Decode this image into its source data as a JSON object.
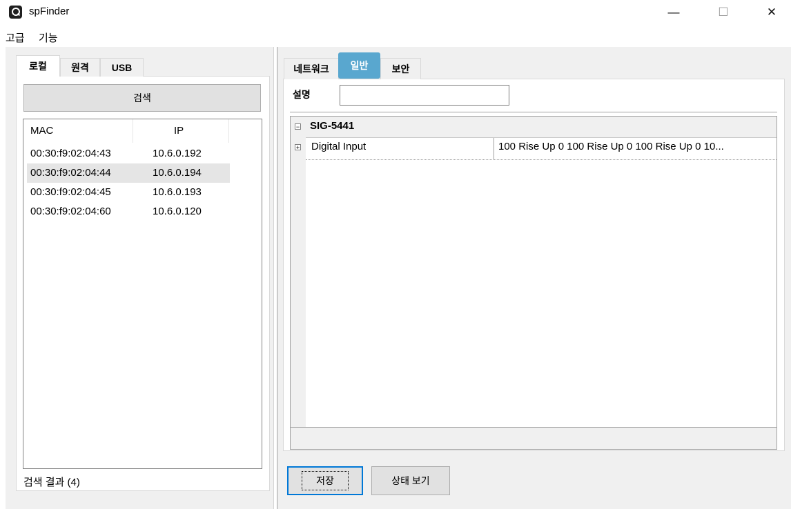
{
  "window": {
    "title": "spFinder",
    "controls": {
      "minimize": "—",
      "maximize": "☐",
      "close": "✕"
    }
  },
  "menu": [
    "고급",
    "기능"
  ],
  "left": {
    "tabs": [
      "로컬",
      "원격",
      "USB"
    ],
    "search_button": "검색",
    "columns": [
      "MAC",
      "IP"
    ],
    "rows": [
      {
        "mac": "00:30:f9:02:04:43",
        "ip": "10.6.0.192"
      },
      {
        "mac": "00:30:f9:02:04:44",
        "ip": "10.6.0.194"
      },
      {
        "mac": "00:30:f9:02:04:45",
        "ip": "10.6.0.193"
      },
      {
        "mac": "00:30:f9:02:04:60",
        "ip": "10.6.0.120"
      }
    ],
    "selected_row": 1,
    "result_label": "검색 결과 (4)"
  },
  "right": {
    "tabs": [
      "네트워크",
      "일반",
      "보안"
    ],
    "active_tab": "일반",
    "description_label": "설명",
    "description_value": "",
    "grid": {
      "group": "SIG-5441",
      "group_expander": "⊟",
      "rows": [
        {
          "expander": "+",
          "name": "Digital Input",
          "value": "100 Rise Up 0 100 Rise Up 0 100 Rise Up 0 10..."
        }
      ]
    },
    "buttons": {
      "save": "저장",
      "status": "상태 보기"
    }
  },
  "colors": {
    "tab_highlight": "#59a7cf",
    "selection": "#e5e5e5",
    "default_button_border": "#0078d7"
  }
}
